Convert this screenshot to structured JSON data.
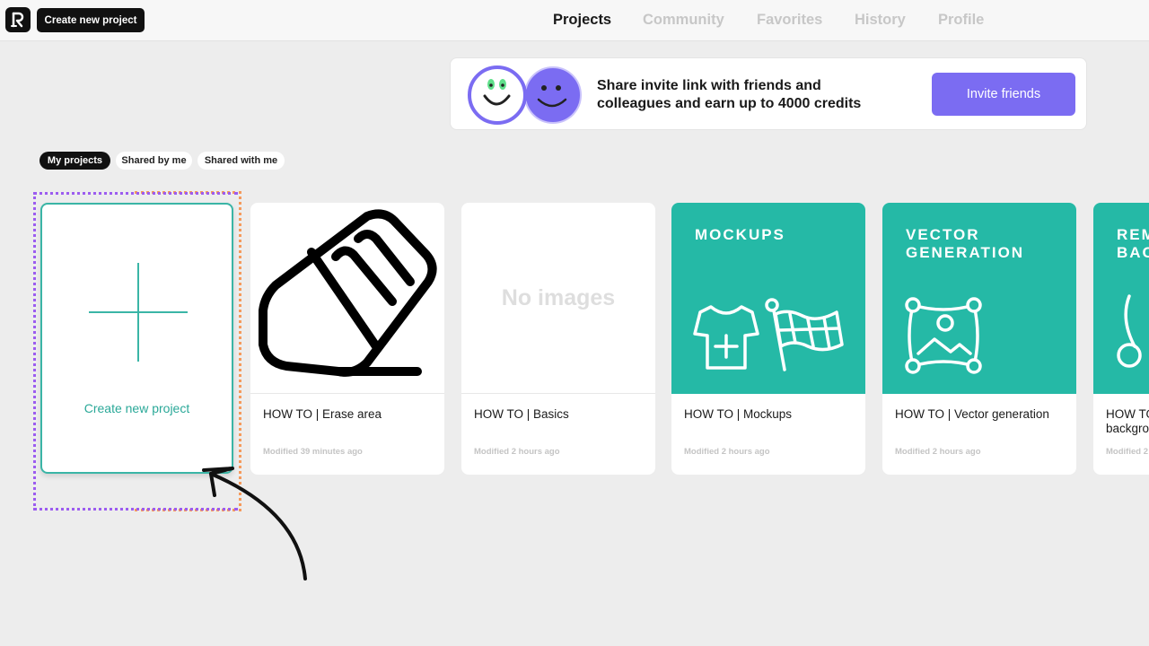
{
  "header": {
    "create_label": "Create new project",
    "nav": [
      "Projects",
      "Community",
      "Favorites",
      "History",
      "Profile"
    ],
    "active_nav": "Projects"
  },
  "banner": {
    "line1": "Share invite link with friends and",
    "line2": "colleagues and earn up to 4000 credits",
    "button_label": "Invite friends"
  },
  "tabs": [
    "My projects",
    "Shared by me",
    "Shared with me"
  ],
  "new_project": {
    "label": "Create new project"
  },
  "projects": [
    {
      "title": "HOW TO | Erase area",
      "modified": "Modified 39 minutes ago",
      "thumb": "eraser-icon"
    },
    {
      "title": "HOW TO | Basics",
      "modified": "Modified 2 hours ago",
      "thumb_text": "No images"
    },
    {
      "title": "HOW TO | Mockups",
      "modified": "Modified 2 hours ago",
      "thumb_label": "MOCKUPS"
    },
    {
      "title": "HOW TO | Vector generation",
      "modified": "Modified 2 hours ago",
      "thumb_label": "VECTOR\nGENERATION"
    },
    {
      "title": "HOW TO",
      "title2": "backgro",
      "modified": "Modified 2",
      "thumb_label": "REM\nBAC"
    }
  ],
  "colors": {
    "accent": "#7b6cf2",
    "teal": "#25b9a6",
    "new_border": "#3ab5a6"
  }
}
